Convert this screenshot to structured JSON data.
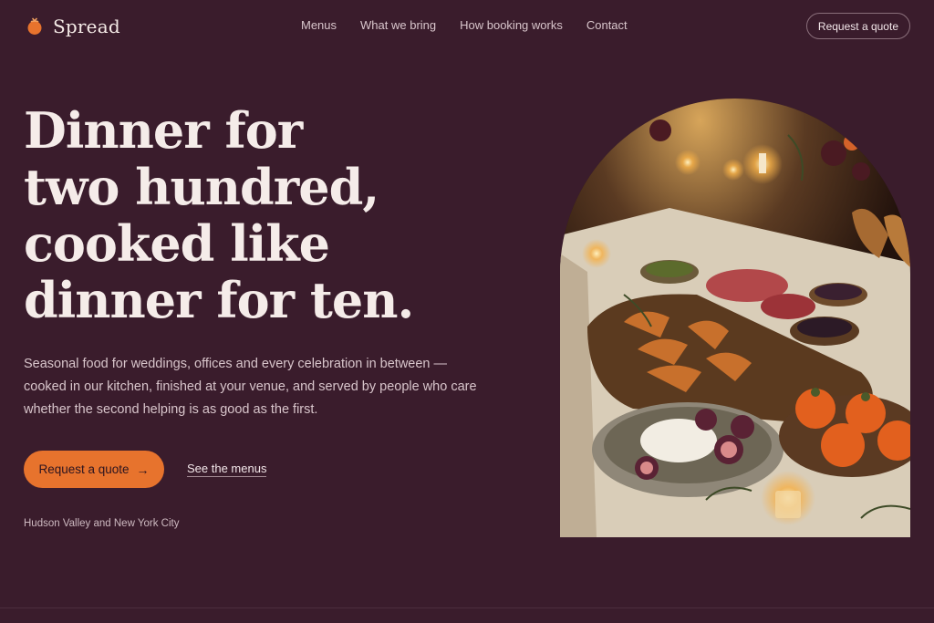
{
  "brand": {
    "name": "Spread",
    "logo_icon": "tomato-icon",
    "accent": "#e7732d"
  },
  "nav": {
    "links": [
      "Menus",
      "What we bring",
      "How booking works",
      "Contact"
    ],
    "cta": "Request a quote"
  },
  "hero": {
    "title_lines": [
      "Dinner for",
      "two hundred,",
      "cooked like",
      "dinner for ten."
    ],
    "description": "Seasonal food for weddings, offices and every celebration in between — cooked in our kitchen, finished at your venue, and served by people who care whether the second helping is as good as the first.",
    "primary_cta": "Request a quote",
    "primary_cta_icon": "arrow-right-icon",
    "secondary_cta": "See the menus",
    "location": "Hudson Valley and New York City"
  },
  "colors": {
    "background": "#3a1c2c",
    "accent": "#e7732d",
    "text": "#f5ece9"
  }
}
